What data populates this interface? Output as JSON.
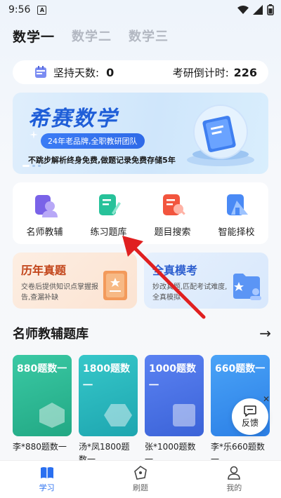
{
  "status": {
    "time": "9:56",
    "notif": "A"
  },
  "top_tabs": [
    {
      "label": "数学一"
    },
    {
      "label": "数学二"
    },
    {
      "label": "数学三"
    }
  ],
  "counter": {
    "persist_label": "坚持天数:",
    "persist_value": "0",
    "countdown_label": "考研倒计时:",
    "countdown_value": "226"
  },
  "banner": {
    "title": "希赛数学",
    "pill": "24年老品牌,全职教研团队",
    "subtitle": "不跳步解析终身免费,做题记录免费存储5年"
  },
  "quick": [
    {
      "label": "名师教辅",
      "icon": "teacher-books-icon"
    },
    {
      "label": "练习题库",
      "icon": "practice-bank-icon"
    },
    {
      "label": "题目搜索",
      "icon": "question-search-icon"
    },
    {
      "label": "智能择校",
      "icon": "school-select-icon"
    }
  ],
  "exam_cards": {
    "past": {
      "title": "历年真题",
      "desc": "交卷后提供知识点掌握报告,查漏补缺"
    },
    "mock": {
      "title": "全真模考",
      "desc": "妙改真题,匹配考试难度,全真模拟"
    }
  },
  "section": {
    "title": "名师教辅题库"
  },
  "books": [
    {
      "cover": "880题数一",
      "name": "李*880题数一"
    },
    {
      "cover": "1800题数一",
      "name": "汤*凤1800题数一"
    },
    {
      "cover": "1000题数一",
      "name": "张*1000题数一"
    },
    {
      "cover": "660题数一",
      "name": "李*乐660题数一"
    }
  ],
  "fab": {
    "label": "反馈"
  },
  "nav": [
    {
      "label": "学习"
    },
    {
      "label": "刷题"
    },
    {
      "label": "我的"
    }
  ],
  "colors": {
    "accent": "#2a6ff0",
    "annotation": "#e02020"
  }
}
